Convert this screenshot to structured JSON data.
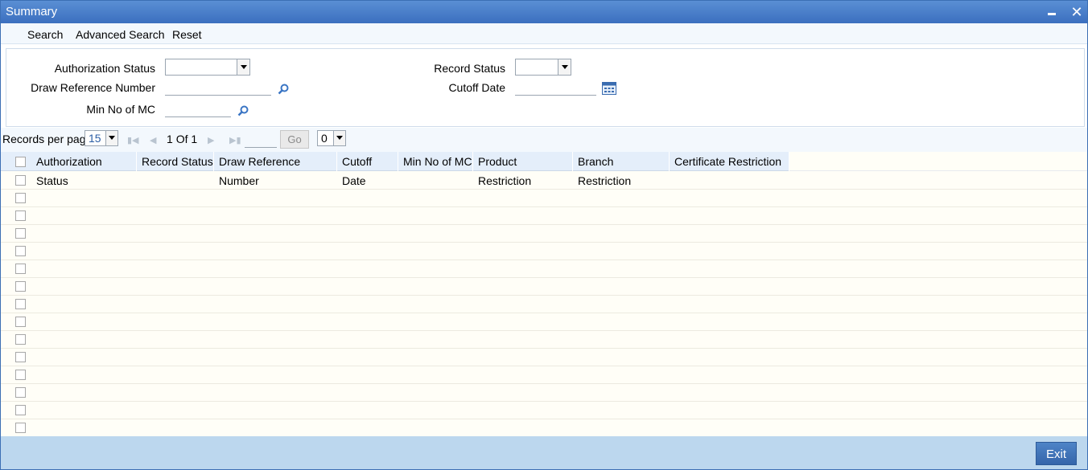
{
  "window": {
    "title": "Summary"
  },
  "menu": {
    "search": "Search",
    "advanced_search": "Advanced Search",
    "reset": "Reset"
  },
  "search_form": {
    "authorization_status_label": "Authorization Status",
    "authorization_status_value": "",
    "draw_reference_number_label": "Draw Reference Number",
    "draw_reference_number_value": "",
    "min_no_of_mc_label": "Min No of MC",
    "min_no_of_mc_value": "",
    "record_status_label": "Record Status",
    "record_status_value": "",
    "cutoff_date_label": "Cutoff Date",
    "cutoff_date_value": ""
  },
  "pager": {
    "records_per_page_label": "Records per page",
    "records_per_page_value": "15",
    "current_page": "1",
    "of_label": "Of",
    "total_pages": "1",
    "go_page_value": "",
    "go_label": "Go",
    "extra_select_value": "0"
  },
  "grid": {
    "columns": [
      "Authorization Status",
      "Record Status",
      "Draw Reference Number",
      "Cutoff Date",
      "Min No of MC",
      "Product Restriction",
      "Branch Restriction",
      "Certificate Restriction"
    ],
    "row_count": 15
  },
  "footer": {
    "exit_label": "Exit"
  },
  "colors": {
    "titlebar": "#3b6fbf",
    "header": "#e4eefa",
    "footer": "#bcd7ee",
    "grid_bg": "#fffef7"
  }
}
